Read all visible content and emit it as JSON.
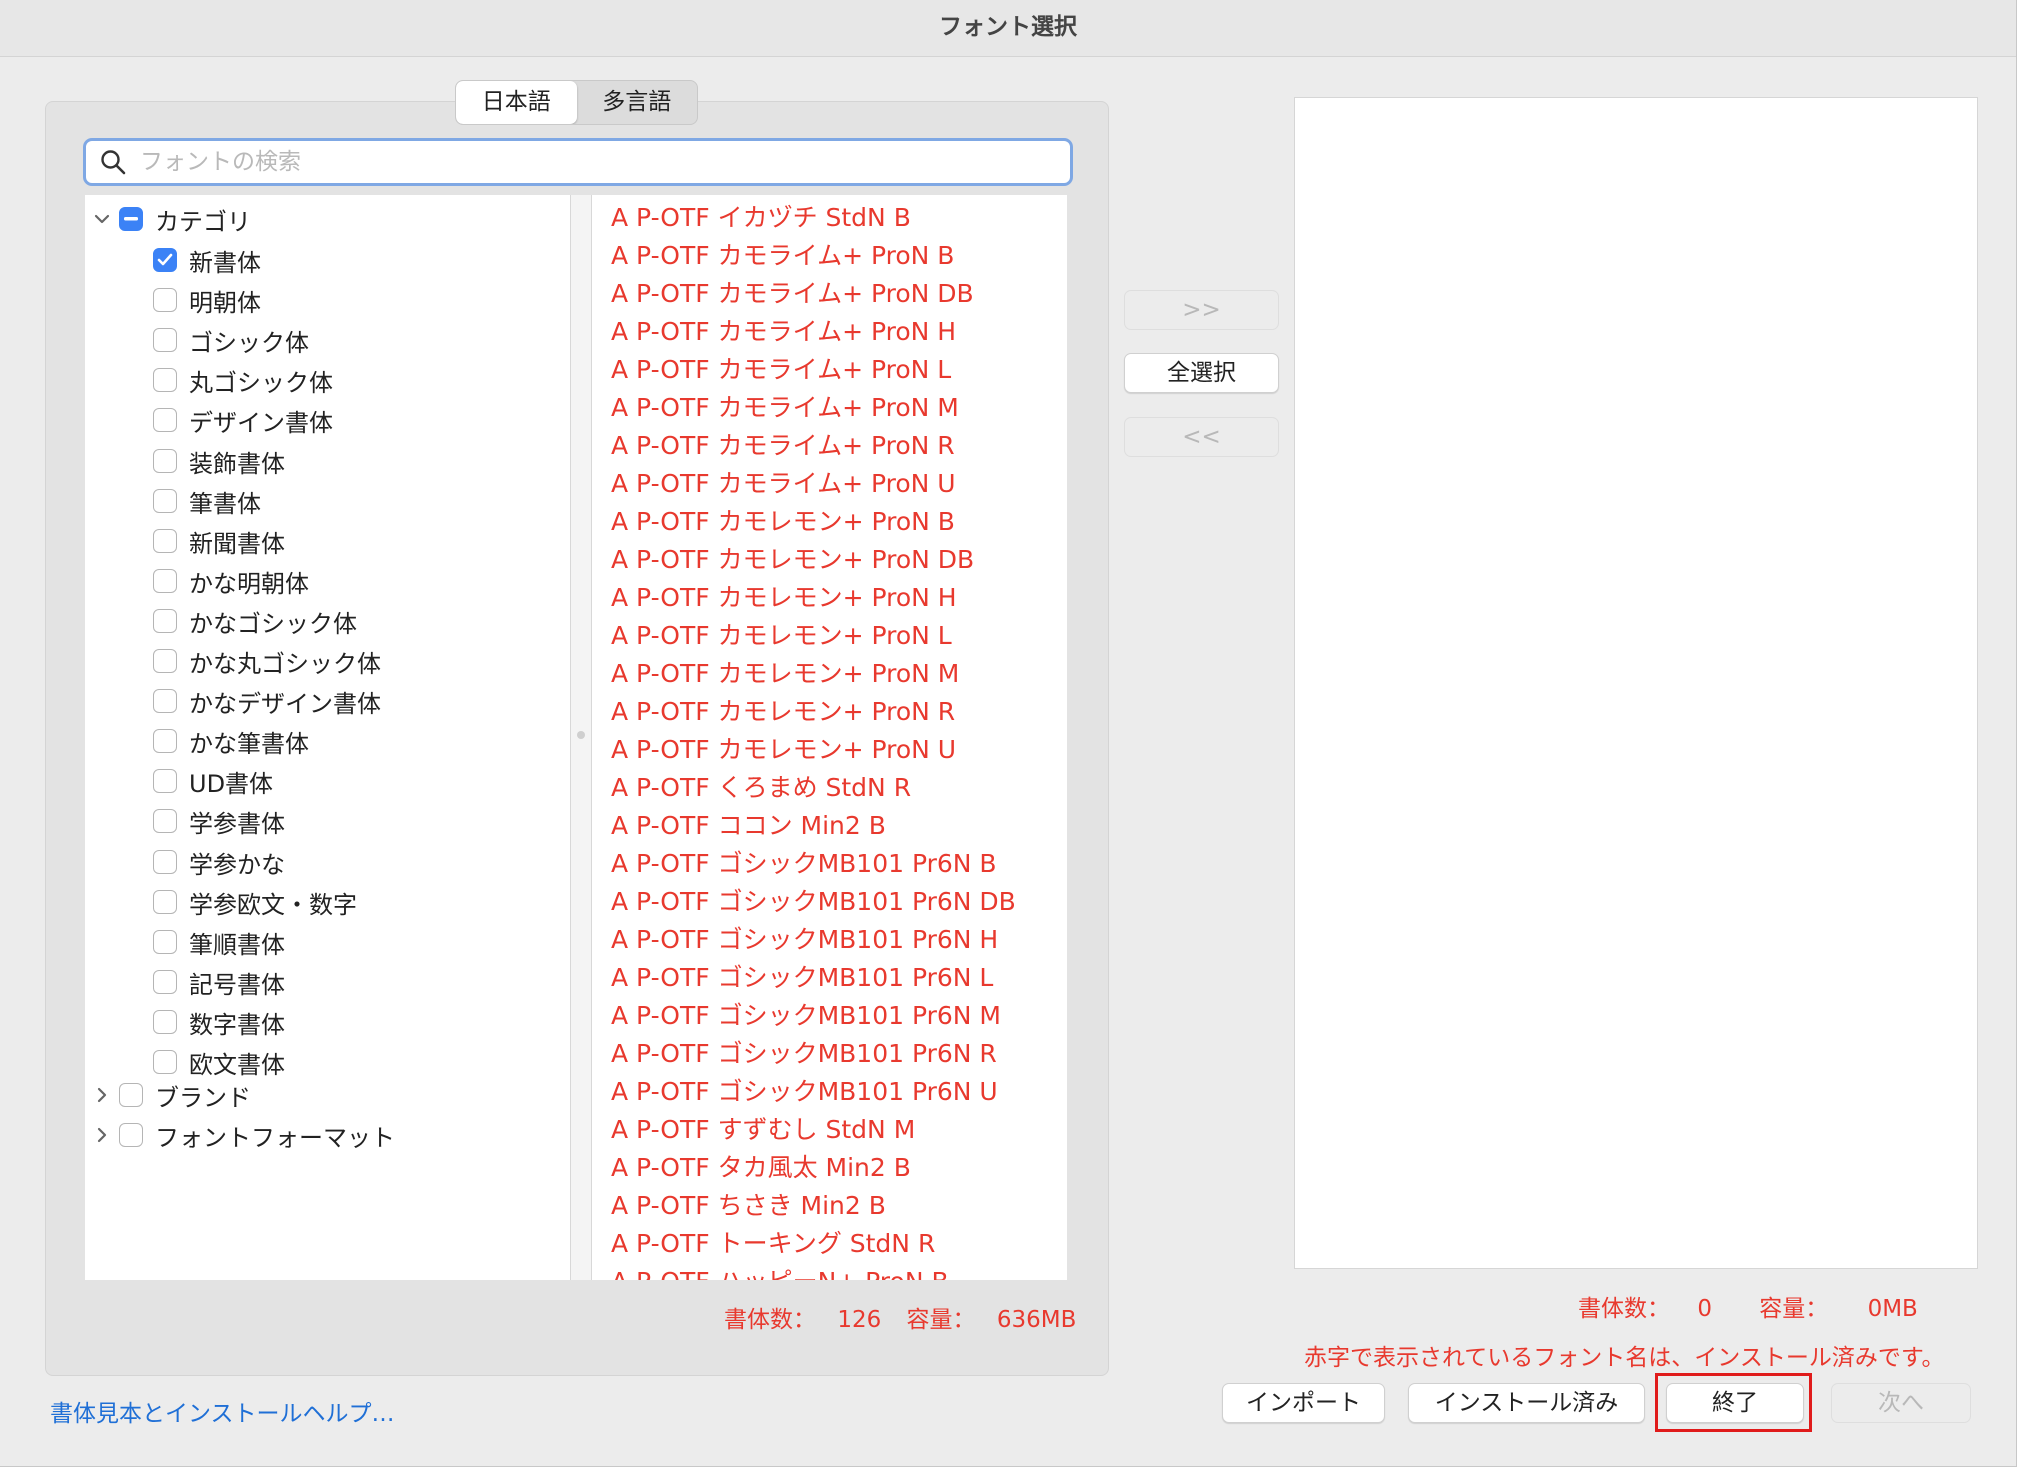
{
  "window": {
    "title": "フォント選択"
  },
  "tabs": [
    {
      "label": "日本語",
      "active": true
    },
    {
      "label": "多言語",
      "active": false
    }
  ],
  "search": {
    "placeholder": "フォントの検索",
    "value": ""
  },
  "tree": {
    "category": {
      "label": "カテゴリ",
      "expanded": true,
      "state": "mixed"
    },
    "category_items": [
      {
        "label": "新書体",
        "checked": true
      },
      {
        "label": "明朝体",
        "checked": false
      },
      {
        "label": "ゴシック体",
        "checked": false
      },
      {
        "label": "丸ゴシック体",
        "checked": false
      },
      {
        "label": "デザイン書体",
        "checked": false
      },
      {
        "label": "装飾書体",
        "checked": false
      },
      {
        "label": "筆書体",
        "checked": false
      },
      {
        "label": "新聞書体",
        "checked": false
      },
      {
        "label": "かな明朝体",
        "checked": false
      },
      {
        "label": "かなゴシック体",
        "checked": false
      },
      {
        "label": "かな丸ゴシック体",
        "checked": false
      },
      {
        "label": "かなデザイン書体",
        "checked": false
      },
      {
        "label": "かな筆書体",
        "checked": false
      },
      {
        "label": "UD書体",
        "checked": false
      },
      {
        "label": "学参書体",
        "checked": false
      },
      {
        "label": "学参かな",
        "checked": false
      },
      {
        "label": "学参欧文・数字",
        "checked": false
      },
      {
        "label": "筆順書体",
        "checked": false
      },
      {
        "label": "記号書体",
        "checked": false
      },
      {
        "label": "数字書体",
        "checked": false
      },
      {
        "label": "欧文書体",
        "checked": false
      }
    ],
    "groups": [
      {
        "label": "ブランド",
        "expanded": false,
        "checked": false
      },
      {
        "label": "フォントフォーマット",
        "expanded": false,
        "checked": false
      }
    ]
  },
  "fonts": [
    "A P-OTF イカヅチ StdN B",
    "A P-OTF カモライム+ ProN B",
    "A P-OTF カモライム+ ProN DB",
    "A P-OTF カモライム+ ProN H",
    "A P-OTF カモライム+ ProN L",
    "A P-OTF カモライム+ ProN M",
    "A P-OTF カモライム+ ProN R",
    "A P-OTF カモライム+ ProN U",
    "A P-OTF カモレモン+ ProN B",
    "A P-OTF カモレモン+ ProN DB",
    "A P-OTF カモレモン+ ProN H",
    "A P-OTF カモレモン+ ProN L",
    "A P-OTF カモレモン+ ProN M",
    "A P-OTF カモレモン+ ProN R",
    "A P-OTF カモレモン+ ProN U",
    "A P-OTF くろまめ StdN R",
    "A P-OTF ココン Min2 B",
    "A P-OTF ゴシックMB101 Pr6N B",
    "A P-OTF ゴシックMB101 Pr6N DB",
    "A P-OTF ゴシックMB101 Pr6N H",
    "A P-OTF ゴシックMB101 Pr6N L",
    "A P-OTF ゴシックMB101 Pr6N M",
    "A P-OTF ゴシックMB101 Pr6N R",
    "A P-OTF ゴシックMB101 Pr6N U",
    "A P-OTF すずむし StdN M",
    "A P-OTF タカ風太 Min2 B",
    "A P-OTF ちさき Min2 B",
    "A P-OTF トーキング StdN R",
    "A P-OTF ハッピーN+ ProN B"
  ],
  "left_status": {
    "count_label": "書体数：",
    "count": "126",
    "size_label": "容量：",
    "size": "636MB"
  },
  "transfer": {
    "add": ">>",
    "select_all": "全選択",
    "remove": "<<"
  },
  "right_status": {
    "count_label": "書体数：",
    "count": "0",
    "size_label": "容量：",
    "size": "0MB"
  },
  "note": "赤字で表示されているフォント名は、インストール済みです。",
  "help_link": "書体見本とインストールヘルプ…",
  "buttons": {
    "import": "インポート",
    "installed": "インストール済み",
    "quit": "終了",
    "next": "次へ"
  },
  "colors": {
    "installed_red": "#e8392e",
    "accent_blue": "#3b82f6",
    "link_blue": "#1f6fd6",
    "highlight_red": "#e01b1b"
  }
}
